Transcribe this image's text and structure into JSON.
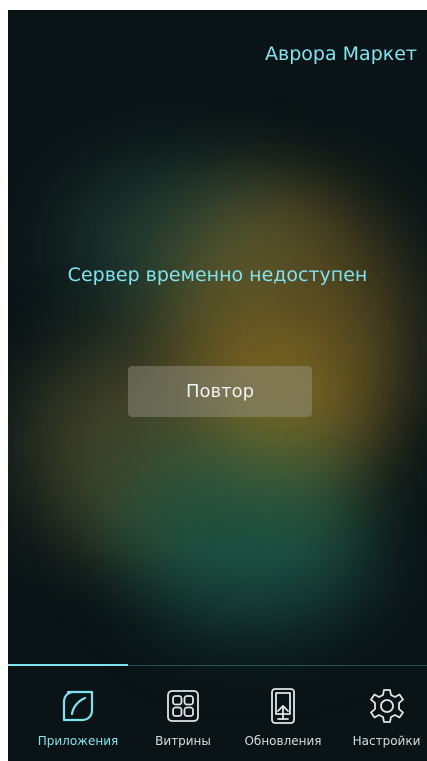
{
  "header": {
    "app_title": "Аврора Маркет"
  },
  "main": {
    "error_message": "Сервер временно недоступен",
    "retry_label": "Повтор"
  },
  "tabs": [
    {
      "label": "Приложения",
      "icon": "leaf-icon",
      "active": true
    },
    {
      "label": "Витрины",
      "icon": "grid-icon",
      "active": false
    },
    {
      "label": "Обновления",
      "icon": "update-icon",
      "active": false
    },
    {
      "label": "Настройки",
      "icon": "gear-icon",
      "active": false
    }
  ],
  "colors": {
    "accent": "#7fe3ee",
    "background": "#0b1517",
    "button": "#8e8e86"
  }
}
